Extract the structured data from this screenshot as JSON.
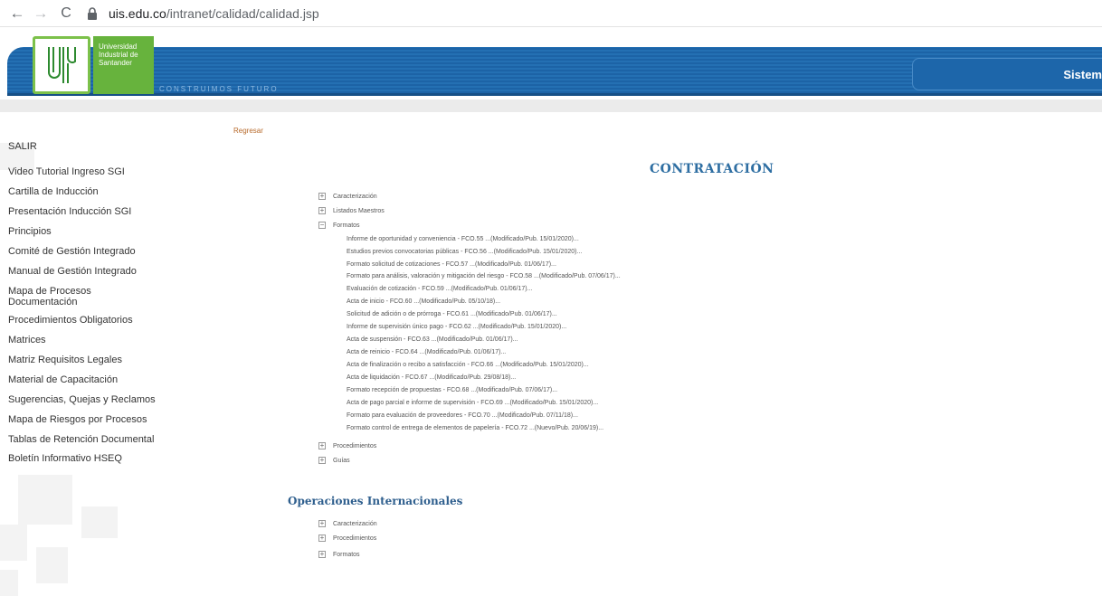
{
  "browser": {
    "back": "←",
    "forward": "→",
    "reload": "C",
    "url_host": "uis.edu.co",
    "url_path": "/intranet/calidad/calidad.jsp"
  },
  "header": {
    "logo_line1": "Universidad",
    "logo_line2": "Industrial de",
    "logo_line3": "Santander",
    "slogan": "CONSTRUIMOS FUTURO",
    "system_label": "Sistem"
  },
  "regresar": "Regresar",
  "sidebar": {
    "items": [
      "SALIR",
      "Video Tutorial Ingreso SGI",
      "Cartilla de Inducción",
      "Presentación Inducción SGI",
      "Principios",
      "Comité de Gestión Integrado",
      "Manual de Gestión Integrado",
      "Mapa de Procesos Documentación",
      "Procedimientos Obligatorios",
      "Matrices",
      "Matriz Requisitos Legales",
      "Material de Capacitación",
      "Sugerencias, Quejas y Reclamos",
      "Mapa de Riesgos por Procesos",
      "Tablas de Retención Documental",
      "Boletín Informativo HSEQ"
    ]
  },
  "contratacion": {
    "title": "CONTRATACIÓN",
    "nodes": [
      {
        "label": "Caracterización",
        "toggle": "+"
      },
      {
        "label": "Listados Maestros",
        "toggle": "+"
      },
      {
        "label": "Formatos",
        "toggle": "−"
      },
      {
        "label": "Procedimientos",
        "toggle": "+"
      },
      {
        "label": "Guías",
        "toggle": "+"
      }
    ],
    "formatos": [
      "Informe de oportunidad y conveniencia - FCO.55 ...(Modificado/Pub. 15/01/2020)...",
      "Estudios previos convocatorias públicas - FCO.56 ...(Modificado/Pub. 15/01/2020)...",
      "Formato solicitud de cotizaciones - FCO.57 ...(Modificado/Pub. 01/06/17)...",
      "Formato para análisis, valoración y mitigación del riesgo - FCO.58 ...(Modificado/Pub. 07/06/17)...",
      "Evaluación de cotización - FCO.59 ...(Modificado/Pub. 01/06/17)...",
      "Acta de inicio - FCO.60 ...(Modificado/Pub. 05/10/18)...",
      "Solicitud de adición o de prórroga - FCO.61 ...(Modificado/Pub. 01/06/17)...",
      "Informe de supervisión único pago - FCO.62 ...(Modificado/Pub. 15/01/2020)...",
      "Acta de suspensión - FCO.63 ...(Modificado/Pub. 01/06/17)...",
      "Acta de reinicio - FCO.64 ...(Modificado/Pub. 01/06/17)...",
      "Acta de finalización o recibo a satisfacción - FCO.66 ...(Modificado/Pub. 15/01/2020)...",
      "Acta de liquidación - FCO.67 ...(Modificado/Pub. 29/08/18)...",
      "Formato recepción de propuestas - FCO.68 ...(Modificado/Pub. 07/06/17)...",
      "Acta de pago parcial e informe de supervisión - FCO.69 ...(Modificado/Pub. 15/01/2020)...",
      "Formato para evaluación de proveedores - FCO.70 ...(Modificado/Pub. 07/11/18)...",
      "Formato control de entrega de elementos de papelería - FCO.72 ...(Nuevo/Pub. 20/06/19)..."
    ]
  },
  "operaciones": {
    "title": "Operaciones Internacionales",
    "nodes": [
      {
        "label": "Caracterización",
        "toggle": "+"
      },
      {
        "label": "Procedimientos",
        "toggle": "+"
      },
      {
        "label": "Formatos",
        "toggle": "+"
      }
    ]
  }
}
